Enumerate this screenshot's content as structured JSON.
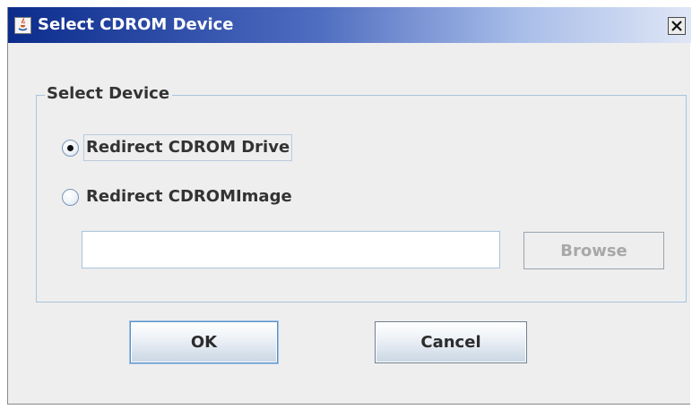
{
  "window": {
    "title": "Select CDROM Device"
  },
  "group": {
    "title": "Select Device"
  },
  "options": [
    {
      "label": "Redirect CDROM Drive",
      "selected": true
    },
    {
      "label": "Redirect CDROMImage",
      "selected": false
    }
  ],
  "image_path": {
    "value": "",
    "placeholder": ""
  },
  "buttons": {
    "browse": "Browse",
    "ok": "OK",
    "cancel": "Cancel"
  },
  "icons": {
    "app": "java-app-icon",
    "close": "close-icon"
  },
  "colors": {
    "titlebar_start": "#0c2c8c",
    "titlebar_end": "#dfe6f6",
    "window_bg": "#eeeeee",
    "border_accent": "#a8c4de"
  }
}
